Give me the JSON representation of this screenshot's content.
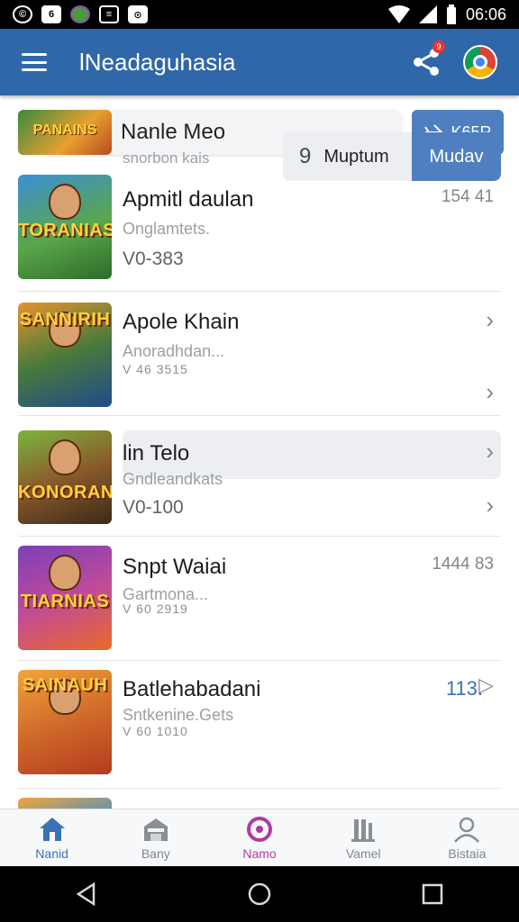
{
  "status_bar": {
    "time": "06:06",
    "icons": [
      "©",
      "6",
      "",
      "≡",
      "⊙"
    ]
  },
  "app_bar": {
    "title": "lNeadaguhasia",
    "notification_count": "9"
  },
  "featured": {
    "title": "Nanle Meo",
    "subtitle": "snorbon kais",
    "button_label": "K65R",
    "thumb_label": "PANAINS"
  },
  "items": [
    {
      "title": "Apmitl daulan",
      "subtitle": "Onglamtets.",
      "version": "V0-383",
      "meta": "154 41",
      "thumb_label": "TORANIAS",
      "colors": [
        "#3b8fd6",
        "#2d6b2a"
      ]
    },
    {
      "title": "Apole Khain",
      "subtitle": "Anoradhdan...",
      "version": "V 46 3515",
      "meta": "",
      "thumb_label": "SANNIRIH",
      "colors": [
        "#e49430",
        "#1f4a8a"
      ]
    },
    {
      "title": "lin Telo",
      "subtitle": "Gndleandkats",
      "version": "V0-100",
      "meta": "",
      "thumb_label": "KONORAN",
      "colors": [
        "#7bb53e",
        "#3a2a1a"
      ]
    },
    {
      "title": "Snpt Waiai",
      "subtitle": "Gartmona...",
      "version": "V 60 2919",
      "meta": "1444 83",
      "thumb_label": "TIARNIAS",
      "colors": [
        "#7b3fb8",
        "#e96a28"
      ]
    },
    {
      "title": "Batlehabadani",
      "subtitle": "Sntkenine.Gets",
      "version": "V 60 1010",
      "meta": "113.",
      "thumb_label": "SAINAUH",
      "colors": [
        "#f0a43a",
        "#b33b1f"
      ]
    }
  ],
  "split_control": {
    "left_label": "Muptum",
    "left_prefix": "9",
    "right_label": "Mudav"
  },
  "bottom_nav": [
    {
      "label": "Nanid",
      "icon": "home-icon"
    },
    {
      "label": "Bany",
      "icon": "store-icon"
    },
    {
      "label": "Namo",
      "icon": "circle-target-icon"
    },
    {
      "label": "Vamel",
      "icon": "columns-icon"
    },
    {
      "label": "Bistaia",
      "icon": "person-icon"
    }
  ],
  "colors": {
    "app_bar": "#2f67a8",
    "accent": "#4f7fc0",
    "purple": "#b23aa0"
  }
}
